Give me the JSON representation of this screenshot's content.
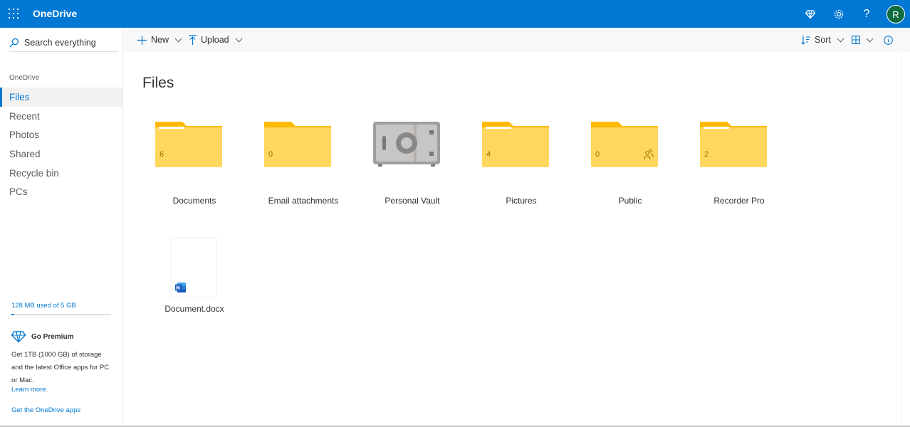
{
  "topbar": {
    "brand": "OneDrive",
    "avatar_initial": "R",
    "icons": [
      "app-launcher-icon",
      "premium-diamond-icon",
      "settings-gear-icon",
      "help-icon"
    ],
    "accent_color": "#0078d4"
  },
  "sidebar": {
    "search_placeholder": "Search everything",
    "section_title": "OneDrive",
    "items": [
      {
        "label": "Files"
      },
      {
        "label": "Recent"
      },
      {
        "label": "Photos"
      },
      {
        "label": "Shared"
      },
      {
        "label": "Recycle bin"
      },
      {
        "label": "PCs"
      }
    ],
    "storage_text": "128 MB used of 5 GB",
    "storage_used_fraction": 0.025,
    "premium_title": "Go Premium",
    "premium_text": "Get 1TB (1000 GB) of storage and the latest Office apps for PC or Mac.",
    "learn_more": "Learn more.",
    "get_apps": "Get the OneDrive apps"
  },
  "commandbar": {
    "new_label": "New",
    "upload_label": "Upload",
    "sort_label": "Sort"
  },
  "main": {
    "title": "Files",
    "folders": [
      {
        "name": "Documents",
        "count": "6"
      },
      {
        "name": "Email attachments",
        "count": "0"
      },
      {
        "name": "Personal Vault",
        "count": ""
      },
      {
        "name": "Pictures",
        "count": "4"
      },
      {
        "name": "Public",
        "count": "0"
      },
      {
        "name": "Recorder Pro",
        "count": "2"
      }
    ],
    "files": [
      {
        "name": "Document.docx"
      }
    ]
  }
}
